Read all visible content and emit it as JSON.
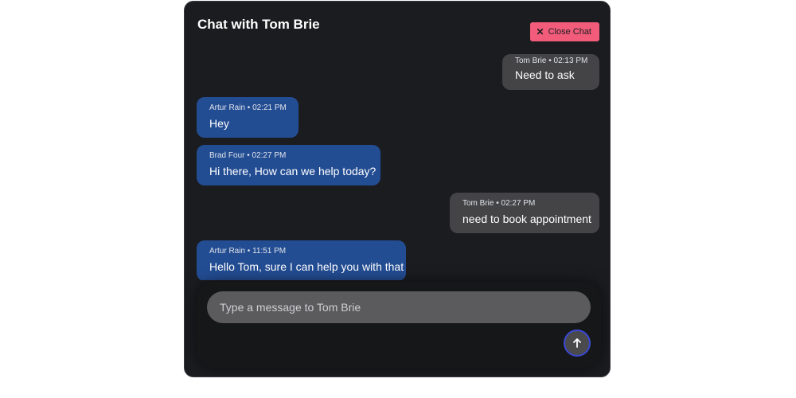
{
  "header": {
    "title": "Chat with Tom Brie",
    "close_button_icon": "close-icon",
    "close_button_label": "Close Chat"
  },
  "messages": [
    {
      "role": "customer",
      "author": "Tom Brie",
      "time": "02:13 PM",
      "meta": "Tom Brie • 02:13 PM",
      "text": "Need to ask"
    },
    {
      "role": "agent",
      "author": "Artur Rain",
      "time": "02:21 PM",
      "meta": "Artur Rain • 02:21 PM",
      "text": "Hey"
    },
    {
      "role": "agent",
      "author": "Brad Four",
      "time": "02:27 PM",
      "meta": "Brad Four • 02:27 PM",
      "text": "Hi there, How can we help today?"
    },
    {
      "role": "customer",
      "author": "Tom Brie",
      "time": "02:27 PM",
      "meta": "Tom Brie • 02:27 PM",
      "text": "need to book appointment"
    },
    {
      "role": "agent",
      "author": "Artur Rain",
      "time": "11:51 PM",
      "meta": "Artur Rain • 11:51 PM",
      "text": "Hello Tom, sure I can help you with that"
    }
  ],
  "composer": {
    "placeholder": "Type a message to Tom Brie",
    "value": "",
    "send_icon": "arrow-up-icon"
  },
  "colors": {
    "window_bg": "#1b1c20",
    "agent_bubble": "#234d93",
    "customer_bubble": "#444446",
    "close_button": "#f25c7a",
    "send_ring": "#3b49d6"
  }
}
